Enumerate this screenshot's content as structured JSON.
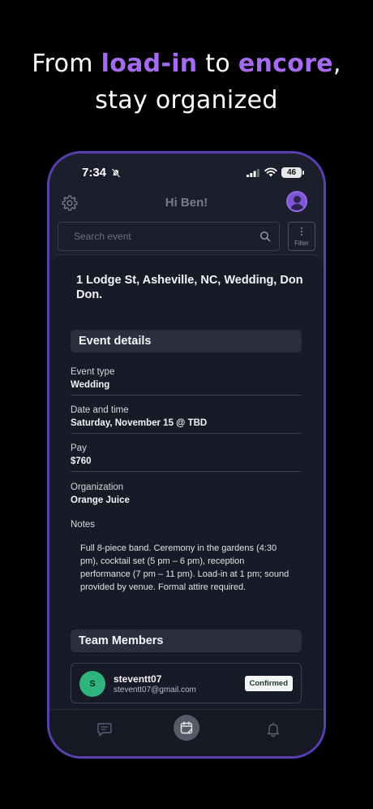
{
  "headline": {
    "part1": "From ",
    "accent1": "load-in",
    "part2": " to ",
    "accent2": "encore",
    "part3": ",",
    "line2": "stay organized"
  },
  "status_bar": {
    "time": "7:34",
    "battery": "46"
  },
  "header": {
    "greeting": "Hi Ben!"
  },
  "search": {
    "placeholder": "Search event"
  },
  "filter": {
    "label": "Filter"
  },
  "event": {
    "address": "1 Lodge St, Asheville, NC, Wedding, Don Don.",
    "details_title": "Event details",
    "fields": [
      {
        "label": "Event type",
        "value": "Wedding"
      },
      {
        "label": "Date and time",
        "value": "Saturday, November 15 @ TBD"
      },
      {
        "label": "Pay",
        "value": "$760"
      },
      {
        "label": "Organization",
        "value": "Orange Juice"
      }
    ],
    "notes_label": "Notes",
    "notes": "Full 8-piece band. Ceremony in the gardens (4:30 pm), cocktail set (5 pm – 6 pm), reception performance (7 pm – 11 pm). Load-in at 1 pm; sound provided by venue. Formal attire required."
  },
  "team": {
    "title": "Team Members",
    "members": [
      {
        "initial": "S",
        "name": "steventt07",
        "email": "steventt07@gmail.com",
        "status": "Confirmed"
      }
    ]
  },
  "colors": {
    "accent": "#a46bf0",
    "phone_frame": "#5a3fb3",
    "confirmed_avatar": "#2fb47d"
  },
  "icons": [
    "bell-off-icon",
    "signal-icon",
    "wifi-icon",
    "battery-icon",
    "gear-icon",
    "avatar",
    "search-icon",
    "more-vertical-icon",
    "messages-icon",
    "calendar-icon",
    "bell-icon"
  ]
}
